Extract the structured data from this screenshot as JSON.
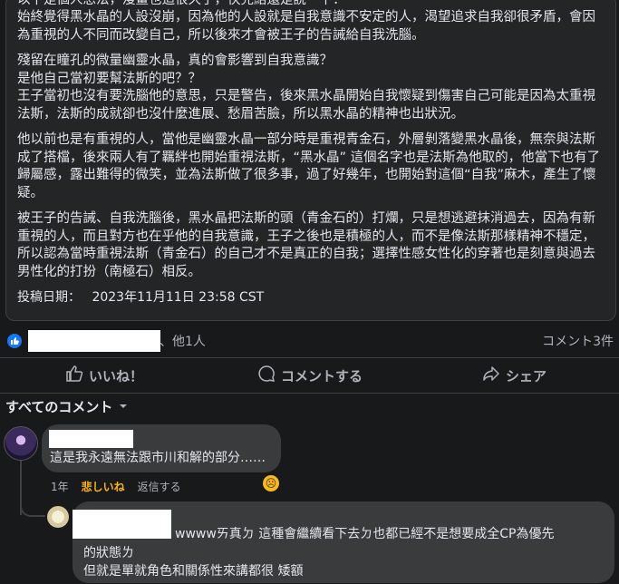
{
  "post": {
    "paragraphs": [
      "以下是個人想法，漫畫也追很久了，快完結還是說一下：",
      "始終覺得黑水晶的人設沒崩，因為他的人設就是自我意識不安定的人，渴望追求自我卻很矛盾，會因為重視的人不同而改變自己，所以後來才會被王子的告誡給自我洗腦。",
      "殘留在瞳孔的微量幽靈水晶，真的會影響到自我意識？",
      "是他自己當初要幫法斯的吧？？",
      "王子當初也沒有要洗腦他的意思，只是警告，後來黑水晶開始自我懷疑到傷害自己可能是因為太重視法斯，法斯的成就卻也沒什麼進展、愁眉苦臉，所以黑水晶的精神也出狀況。",
      "他以前也是有重視的人，當他是幽靈水晶一部分時是重視青金石，外層剝落變黑水晶後，無奈與法斯成了搭檔，後來兩人有了羈絆也開始重視法斯，“黑水晶” 這個名字也是法斯為他取的，他當下也有了歸屬感，露出難得的微笑，並為法斯做了很多事，過了好幾年，也開始對這個“自我”麻木，產生了懷疑。",
      "被王子的告誡、自我洗腦後，黑水晶把法斯的頭（青金石的）打爛，只是想逃避抹消過去，因為有新重視的人，而且對方也在乎他的自我意識，王子之後也是積極的人，而不是像法斯那樣精神不穩定，所以認為當時重視法斯（青金石）的自己才不是真正的自我；選擇性感女性化的穿著也是刻意與過去男性化的打扮（南極石）相反。"
    ],
    "posted_label": "投稿日期：",
    "posted_date": "2023年11月11日 23:58 CST"
  },
  "reactions": {
    "others_text": "、他1人",
    "comment_count": "コメント3件"
  },
  "actions": {
    "like": "いいね！",
    "comment": "コメントする",
    "share": "シェア"
  },
  "comments_header": {
    "sort_label": "すべてのコメント"
  },
  "comments": [
    {
      "text": "這是我永遠無法跟市川和解的部分……",
      "time": "1年",
      "reaction_label": "悲しいね",
      "reply_label": "返信する",
      "reaction_icon": "sad-face-icon"
    },
    {
      "line1": "wwwwㄞ真ㄉ 這種會繼續看下去ㄉ也都已經不是想要成全CP為優先",
      "line2": "的狀態ㄌ",
      "line3": "但就是單就角色和關係性來講都很 矮額"
    }
  ],
  "colors": {
    "background": "#18191a",
    "card": "#242526",
    "bubble": "#3a3b3c",
    "accent": "#1877f2",
    "sad": "#f7b125"
  }
}
